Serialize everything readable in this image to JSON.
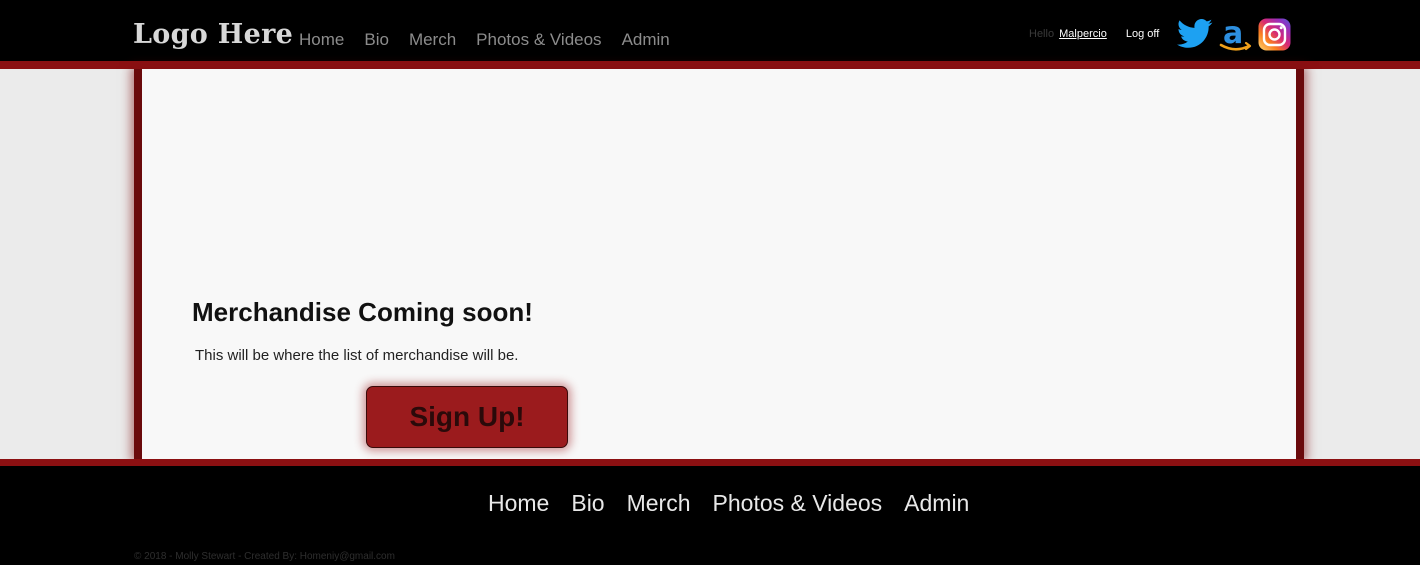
{
  "header": {
    "logo": "Logo Here",
    "nav": [
      "Home",
      "Bio",
      "Merch",
      "Photos & Videos",
      "Admin"
    ],
    "hello": "Hello",
    "username": "Malpercio",
    "logoff": "Log off",
    "social_icons": [
      "twitter-icon",
      "amazon-icon",
      "instagram-icon"
    ]
  },
  "main": {
    "headline": "Merchandise Coming soon!",
    "description": "This will be where the list of merchandise will be.",
    "signup_label": "Sign Up!"
  },
  "footer": {
    "nav": [
      "Home",
      "Bio",
      "Merch",
      "Photos & Videos",
      "Admin"
    ],
    "copyright": "© 2018 - Molly Stewart - Created By: Homeniy@gmail.com"
  },
  "colors": {
    "accent": "#8b1012",
    "button": "#9b1b1d",
    "header_bg": "#000000",
    "panel_bg": "#f8f8f8",
    "page_bg": "#ebebeb"
  }
}
